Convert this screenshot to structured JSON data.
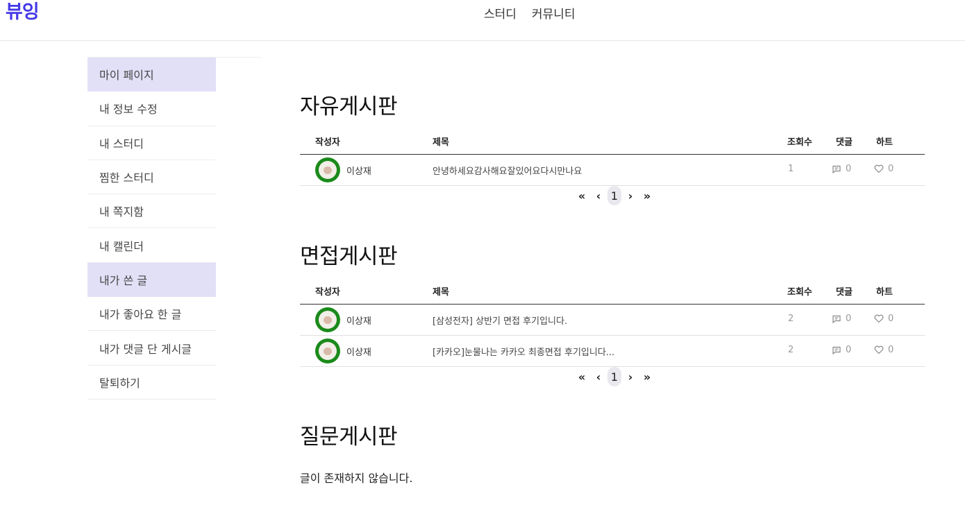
{
  "header": {
    "logo": "뷰잉",
    "nav": [
      "스터디",
      "커뮤니티"
    ]
  },
  "sidebar": {
    "items": [
      {
        "label": "마이 페이지",
        "active": true
      },
      {
        "label": "내 정보 수정",
        "active": false
      },
      {
        "label": "내 스터디",
        "active": false
      },
      {
        "label": "찜한 스터디",
        "active": false
      },
      {
        "label": "내 쪽지함",
        "active": false
      },
      {
        "label": "내 캘린더",
        "active": false
      },
      {
        "label": "내가 쓴 글",
        "active": true
      },
      {
        "label": "내가 좋아요 한 글",
        "active": false
      },
      {
        "label": "내가 댓글 단 게시글",
        "active": false
      },
      {
        "label": "탈퇴하기",
        "active": false
      }
    ]
  },
  "columns": {
    "author": "작성자",
    "title": "제목",
    "views": "조회수",
    "comments": "댓글",
    "hearts": "하트"
  },
  "boards": [
    {
      "title": "자유게시판",
      "rows": [
        {
          "author": "이상재",
          "title": "안녕하세요감사해요잘있어요다시만나요",
          "views": "1",
          "comments": "0",
          "hearts": "0"
        }
      ],
      "page": "1"
    },
    {
      "title": "면접게시판",
      "rows": [
        {
          "author": "이상재",
          "title": "[삼성전자] 상반기 면접 후기입니다.",
          "views": "2",
          "comments": "0",
          "hearts": "0"
        },
        {
          "author": "이상재",
          "title": "[카카오]눈물나는 카카오 최종면접 후기입니다...",
          "views": "2",
          "comments": "0",
          "hearts": "0"
        }
      ],
      "page": "1"
    },
    {
      "title": "질문게시판",
      "empty_message": "글이 존재하지 않습니다."
    }
  ],
  "pager": {
    "first": "«",
    "prev": "‹",
    "next": "›",
    "last": "»"
  },
  "colors": {
    "brand": "#4338e6",
    "sidebar_active": "#e2e0f7",
    "avatar_bg": "#1a8a1a"
  }
}
